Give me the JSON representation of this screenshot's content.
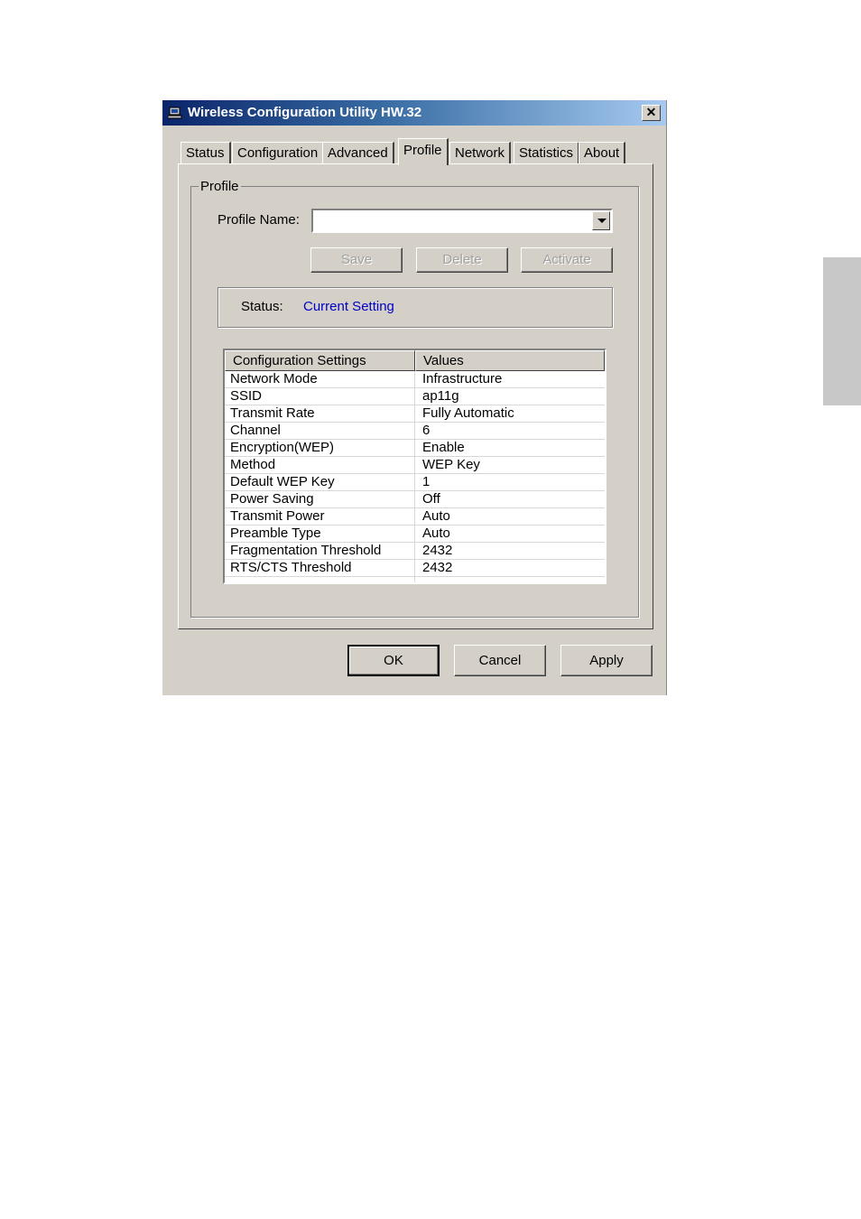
{
  "window": {
    "title": "Wireless Configuration Utility HW.32",
    "close_glyph": "✕",
    "app_icon": "computer-icon"
  },
  "tabs": [
    {
      "label": "Status",
      "active": false
    },
    {
      "label": "Configuration",
      "active": false
    },
    {
      "label": "Advanced",
      "active": false
    },
    {
      "label": "Profile",
      "active": true
    },
    {
      "label": "Network",
      "active": false
    },
    {
      "label": "Statistics",
      "active": false
    },
    {
      "label": "About",
      "active": false
    }
  ],
  "profile": {
    "group_label": "Profile",
    "name_label": "Profile Name:",
    "name_value": "",
    "save_label": "Save",
    "delete_label": "Delete",
    "activate_label": "Activate",
    "status_label": "Status:",
    "status_value": "Current Setting",
    "status_value_color": "#0000c8"
  },
  "settings_table": {
    "headers": [
      "Configuration Settings",
      "Values"
    ],
    "rows": [
      [
        "Network Mode",
        "Infrastructure"
      ],
      [
        "SSID",
        "ap11g"
      ],
      [
        "Transmit Rate",
        "Fully Automatic"
      ],
      [
        "Channel",
        "6"
      ],
      [
        "Encryption(WEP)",
        "Enable"
      ],
      [
        "Method",
        "WEP Key"
      ],
      [
        "Default WEP Key",
        "1"
      ],
      [
        "Power Saving",
        "Off"
      ],
      [
        "Transmit Power",
        "Auto"
      ],
      [
        "Preamble Type",
        "Auto"
      ],
      [
        "Fragmentation Threshold",
        "2432"
      ],
      [
        "RTS/CTS Threshold",
        "2432"
      ]
    ]
  },
  "footer": {
    "ok_label": "OK",
    "cancel_label": "Cancel",
    "apply_label": "Apply"
  }
}
